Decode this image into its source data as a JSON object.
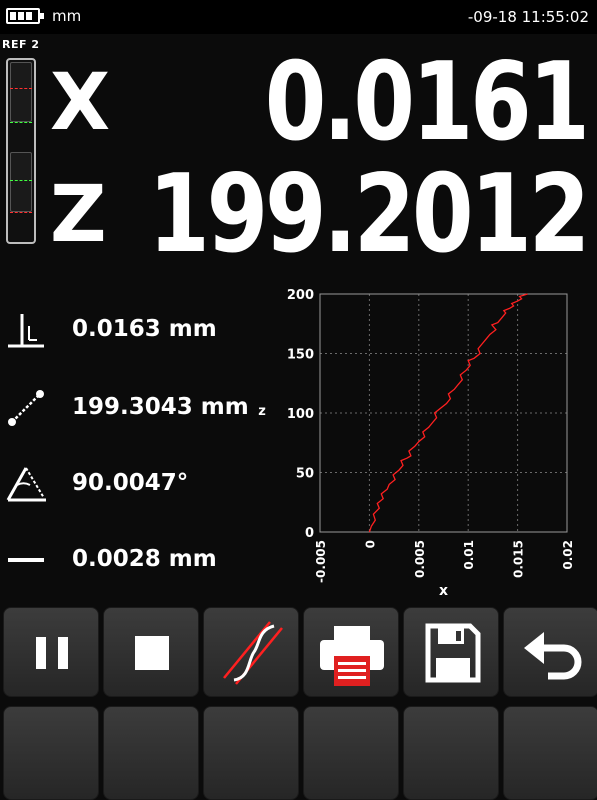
{
  "status": {
    "unit": "mm",
    "datetime": "-09-18 11:55:02",
    "battery_icon": "battery-icon"
  },
  "reference": {
    "label": "REF 2",
    "line_colors": [
      "#ff3030",
      "#40ff40",
      "#40ff40",
      "#ff3030"
    ]
  },
  "axes": [
    {
      "letter": "X",
      "value": "0.0161"
    },
    {
      "letter": "Z",
      "value": "199.2012"
    }
  ],
  "measurements": [
    {
      "icon": "perpendicularity-icon",
      "text": "0.0163 mm"
    },
    {
      "icon": "distance-icon",
      "text": "199.3043 mm"
    },
    {
      "icon": "angle-icon",
      "text": "90.0047°"
    },
    {
      "icon": "straightness-icon",
      "text": "0.0028 mm"
    }
  ],
  "chart_data": {
    "type": "line",
    "xlabel": "x",
    "ylabel": "z",
    "xlim": [
      -0.005,
      0.02
    ],
    "ylim": [
      0,
      200
    ],
    "x_ticks": [
      "-0.005",
      "0",
      "0.005",
      "0.01",
      "0.015",
      "0.02"
    ],
    "y_ticks": [
      "0",
      "50",
      "100",
      "150",
      "200"
    ],
    "grid": true,
    "line_color": "#ff2020",
    "series": [
      {
        "x": [
          0,
          0.0002,
          0.0006,
          0.0004,
          0.001,
          0.0008,
          0.0014,
          0.0012,
          0.0018,
          0.002,
          0.0026,
          0.0024,
          0.003,
          0.0034,
          0.0032,
          0.0038,
          0.0042,
          0.004,
          0.0046,
          0.005,
          0.0056,
          0.0054,
          0.006,
          0.0064,
          0.0068,
          0.0066,
          0.0072,
          0.0078,
          0.0082,
          0.008,
          0.0086,
          0.009,
          0.0094,
          0.0092,
          0.0098,
          0.0102,
          0.01,
          0.0106,
          0.0112,
          0.011,
          0.0114,
          0.0118,
          0.0122,
          0.0128,
          0.0124,
          0.013,
          0.0134,
          0.0138,
          0.0136,
          0.0142,
          0.0146,
          0.0144,
          0.015,
          0.0154,
          0.0152,
          0.0156,
          0.016
        ],
        "y": [
          0,
          5,
          10,
          15,
          20,
          24,
          28,
          32,
          36,
          40,
          44,
          48,
          52,
          56,
          60,
          62,
          64,
          68,
          72,
          76,
          80,
          84,
          88,
          92,
          96,
          100,
          104,
          108,
          112,
          116,
          120,
          124,
          128,
          132,
          136,
          140,
          144,
          146,
          150,
          154,
          158,
          162,
          166,
          170,
          174,
          176,
          180,
          184,
          186,
          188,
          190,
          192,
          194,
          196,
          198,
          199,
          200
        ]
      }
    ]
  },
  "buttons_top": [
    {
      "name": "pause-button",
      "icon": "pause-icon"
    },
    {
      "name": "stop-button",
      "icon": "stop-icon"
    },
    {
      "name": "straightness-view-button",
      "icon": "straightness-curve-icon"
    },
    {
      "name": "print-button",
      "icon": "printer-icon"
    },
    {
      "name": "save-button",
      "icon": "floppy-disk-icon"
    },
    {
      "name": "back-button",
      "icon": "undo-arrow-icon"
    }
  ]
}
